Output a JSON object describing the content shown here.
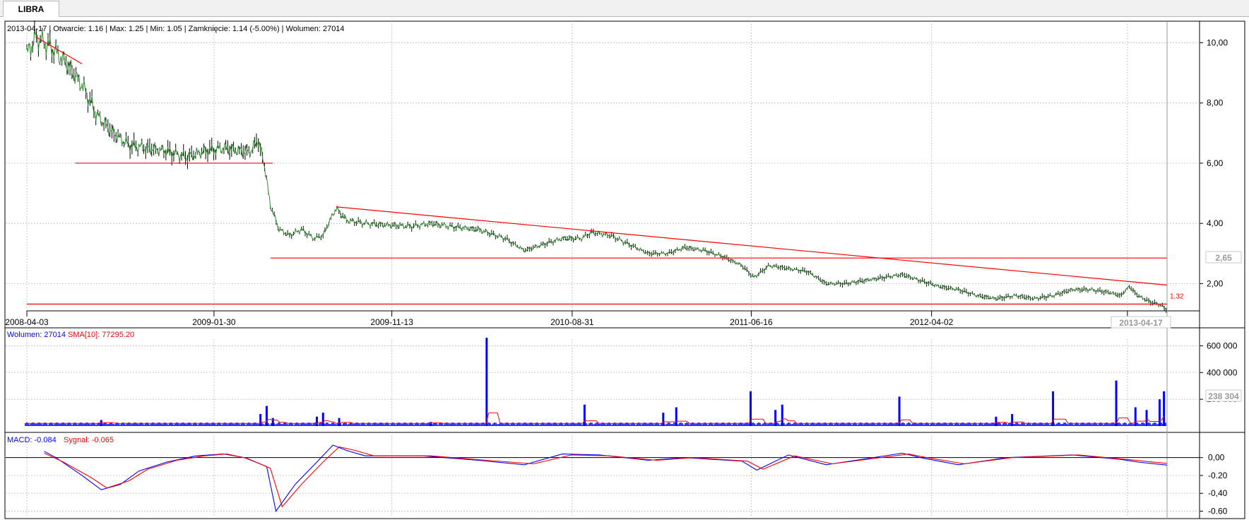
{
  "tab": {
    "label": "LIBRA"
  },
  "colors": {
    "price": "#000000",
    "price_line": "#2f8a2f",
    "trend": "#ff0000",
    "volume": "#0000ff",
    "sma": "#ff0000",
    "macd": "#0000ff",
    "signal": "#ff0000",
    "grid": "#c8c8c8"
  },
  "chart_data": [
    {
      "type": "line",
      "panel": "price",
      "info_text": "2013-04-17 | Otwarcie: 1.16 | Max: 1.25 | Min: 1.05 | Zamknięcie: 1.14 (-5.00%)  | Wolumen: 27014",
      "x_start": "2008-04-03",
      "x_end": "2013-04-17",
      "x_ticks": [
        "2008-04-03",
        "2009-01-30",
        "2009-11-13",
        "2010-08-31",
        "2011-06-16",
        "2012-04-02",
        "2013-0"
      ],
      "x_last_label": "2013-04-17",
      "y_ticks": [
        "10,00",
        "8,00",
        "6,00",
        "4,00",
        "2,00"
      ],
      "ylim": [
        1.0,
        10.2
      ],
      "series": [
        {
          "values": [
            [
              "2008-04-03",
              9.6
            ],
            [
              "2008-04-17",
              10.2
            ],
            [
              "2008-05-15",
              9.8
            ],
            [
              "2008-06-10",
              9.2
            ],
            [
              "2008-07-01",
              8.6
            ],
            [
              "2008-07-25",
              7.6
            ],
            [
              "2008-08-20",
              7.0
            ],
            [
              "2008-09-15",
              6.6
            ],
            [
              "2008-10-15",
              6.5
            ],
            [
              "2008-11-15",
              6.4
            ],
            [
              "2008-12-15",
              6.2
            ],
            [
              "2009-01-15",
              6.4
            ],
            [
              "2009-02-15",
              6.5
            ],
            [
              "2009-03-15",
              6.4
            ],
            [
              "2009-04-01",
              6.4
            ],
            [
              "2009-04-10",
              6.8
            ],
            [
              "2009-04-20",
              6.1
            ],
            [
              "2009-05-01",
              4.6
            ],
            [
              "2009-05-15",
              3.8
            ],
            [
              "2009-06-01",
              3.6
            ],
            [
              "2009-06-20",
              3.8
            ],
            [
              "2009-07-10",
              3.5
            ],
            [
              "2009-07-25",
              3.6
            ],
            [
              "2009-08-05",
              4.1
            ],
            [
              "2009-08-15",
              4.5
            ],
            [
              "2009-09-01",
              4.1
            ],
            [
              "2009-10-01",
              4.0
            ],
            [
              "2009-11-01",
              3.95
            ],
            [
              "2009-12-15",
              3.9
            ],
            [
              "2010-01-15",
              4.0
            ],
            [
              "2010-02-15",
              3.9
            ],
            [
              "2010-04-01",
              3.8
            ],
            [
              "2010-05-15",
              3.5
            ],
            [
              "2010-06-15",
              3.1
            ],
            [
              "2010-07-15",
              3.3
            ],
            [
              "2010-08-15",
              3.5
            ],
            [
              "2010-09-15",
              3.5
            ],
            [
              "2010-10-01",
              3.7
            ],
            [
              "2010-11-01",
              3.6
            ],
            [
              "2010-12-01",
              3.3
            ],
            [
              "2011-01-01",
              3.0
            ],
            [
              "2011-02-01",
              3.0
            ],
            [
              "2011-03-01",
              3.2
            ],
            [
              "2011-04-01",
              3.1
            ],
            [
              "2011-05-01",
              2.9
            ],
            [
              "2011-06-01",
              2.6
            ],
            [
              "2011-06-20",
              2.2
            ],
            [
              "2011-07-15",
              2.6
            ],
            [
              "2011-08-15",
              2.5
            ],
            [
              "2011-09-15",
              2.4
            ],
            [
              "2011-10-15",
              2.0
            ],
            [
              "2011-11-15",
              2.0
            ],
            [
              "2011-12-15",
              2.1
            ],
            [
              "2012-01-15",
              2.2
            ],
            [
              "2012-02-15",
              2.3
            ],
            [
              "2012-03-15",
              2.1
            ],
            [
              "2012-04-15",
              1.9
            ],
            [
              "2012-05-15",
              1.8
            ],
            [
              "2012-06-15",
              1.6
            ],
            [
              "2012-07-15",
              1.5
            ],
            [
              "2012-08-15",
              1.6
            ],
            [
              "2012-09-15",
              1.5
            ],
            [
              "2012-10-15",
              1.6
            ],
            [
              "2012-11-15",
              1.8
            ],
            [
              "2012-12-15",
              1.8
            ],
            [
              "2013-01-15",
              1.7
            ],
            [
              "2013-02-01",
              1.6
            ],
            [
              "2013-02-15",
              1.9
            ],
            [
              "2013-03-01",
              1.6
            ],
            [
              "2013-03-20",
              1.4
            ],
            [
              "2013-04-05",
              1.3
            ],
            [
              "2013-04-17",
              1.14
            ]
          ]
        }
      ],
      "trend_lines": [
        {
          "x": [
            "2008-04-17",
            "2008-07-01"
          ],
          "y": [
            10.2,
            9.3
          ]
        },
        {
          "x": [
            "2008-06-20",
            "2009-05-05"
          ],
          "y": [
            6.0,
            6.0
          ]
        },
        {
          "x": [
            "2009-05-01",
            "2013-04-17"
          ],
          "y": [
            2.85,
            2.85
          ]
        },
        {
          "x": [
            "2009-08-15",
            "2013-04-17"
          ],
          "y": [
            4.55,
            1.95
          ]
        },
        {
          "x": [
            "2008-04-03",
            "2013-04-17"
          ],
          "y": [
            1.32,
            1.32
          ]
        }
      ],
      "price_box": "2,65",
      "level_label": "1,32"
    },
    {
      "type": "bar",
      "panel": "volume",
      "legend": [
        {
          "label": "Wolumen: 27014",
          "color": "#0000ff"
        },
        {
          "label": "SMA[10]: 77295.20",
          "color": "#ff0000"
        }
      ],
      "y_ticks": [
        "600 000",
        "400 000",
        "200 000"
      ],
      "ylim": [
        0,
        650000
      ],
      "box_label": "238 304",
      "spikes": [
        [
          "2008-08-01",
          45000
        ],
        [
          "2009-04-15",
          90000
        ],
        [
          "2009-04-25",
          150000
        ],
        [
          "2009-05-05",
          60000
        ],
        [
          "2009-07-15",
          70000
        ],
        [
          "2009-07-25",
          100000
        ],
        [
          "2009-08-20",
          60000
        ],
        [
          "2010-01-15",
          30000
        ],
        [
          "2010-04-15",
          660000
        ],
        [
          "2010-09-20",
          160000
        ],
        [
          "2011-01-25",
          100000
        ],
        [
          "2011-02-15",
          140000
        ],
        [
          "2011-06-15",
          260000
        ],
        [
          "2011-07-25",
          120000
        ],
        [
          "2011-08-05",
          160000
        ],
        [
          "2012-02-10",
          220000
        ],
        [
          "2012-07-15",
          70000
        ],
        [
          "2012-08-10",
          90000
        ],
        [
          "2012-10-15",
          260000
        ],
        [
          "2013-01-25",
          340000
        ],
        [
          "2013-02-25",
          140000
        ],
        [
          "2013-03-15",
          120000
        ],
        [
          "2013-04-05",
          200000
        ],
        [
          "2013-04-12",
          260000
        ]
      ],
      "base_level": 18000
    },
    {
      "type": "line",
      "panel": "macd",
      "legend": [
        {
          "label": "MACD: -0.084",
          "color": "#0000ff"
        },
        {
          "label": "Sygnał: -0.065",
          "color": "#ff0000"
        }
      ],
      "y_ticks": [
        "0,00",
        "-0.20",
        "-0,40",
        "-0.60"
      ],
      "ylim": [
        -0.62,
        0.14
      ],
      "series": [
        {
          "label": "MACD",
          "values": [
            [
              "2008-05-01",
              0.07
            ],
            [
              "2008-05-20",
              0.0
            ],
            [
              "2008-07-01",
              -0.2
            ],
            [
              "2008-08-01",
              -0.36
            ],
            [
              "2008-09-01",
              -0.3
            ],
            [
              "2008-10-01",
              -0.15
            ],
            [
              "2008-11-15",
              -0.05
            ],
            [
              "2009-01-01",
              0.02
            ],
            [
              "2009-02-15",
              0.04
            ],
            [
              "2009-03-20",
              0.0
            ],
            [
              "2009-04-25",
              -0.1
            ],
            [
              "2009-05-10",
              -0.6
            ],
            [
              "2009-06-10",
              -0.3
            ],
            [
              "2009-07-15",
              -0.05
            ],
            [
              "2009-08-10",
              0.14
            ],
            [
              "2009-09-01",
              0.08
            ],
            [
              "2009-10-01",
              0.02
            ],
            [
              "2010-01-01",
              0.02
            ],
            [
              "2010-04-01",
              -0.03
            ],
            [
              "2010-06-15",
              -0.08
            ],
            [
              "2010-08-15",
              0.04
            ],
            [
              "2010-10-15",
              0.03
            ],
            [
              "2011-01-01",
              -0.03
            ],
            [
              "2011-03-01",
              0.0
            ],
            [
              "2011-06-01",
              -0.04
            ],
            [
              "2011-06-25",
              -0.14
            ],
            [
              "2011-08-15",
              0.03
            ],
            [
              "2011-10-15",
              -0.08
            ],
            [
              "2012-02-15",
              0.05
            ],
            [
              "2012-03-15",
              0.0
            ],
            [
              "2012-05-15",
              -0.08
            ],
            [
              "2012-08-01",
              0.0
            ],
            [
              "2012-11-15",
              0.03
            ],
            [
              "2013-02-01",
              -0.02
            ],
            [
              "2013-03-01",
              -0.05
            ],
            [
              "2013-04-17",
              -0.084
            ]
          ]
        },
        {
          "label": "Sygnał",
          "values": [
            [
              "2008-05-01",
              0.05
            ],
            [
              "2008-06-01",
              -0.05
            ],
            [
              "2008-07-15",
              -0.22
            ],
            [
              "2008-08-10",
              -0.34
            ],
            [
              "2008-09-15",
              -0.26
            ],
            [
              "2008-10-15",
              -0.13
            ],
            [
              "2008-12-01",
              -0.03
            ],
            [
              "2009-01-15",
              0.02
            ],
            [
              "2009-02-20",
              0.04
            ],
            [
              "2009-03-25",
              -0.01
            ],
            [
              "2009-05-01",
              -0.12
            ],
            [
              "2009-05-20",
              -0.55
            ],
            [
              "2009-06-20",
              -0.3
            ],
            [
              "2009-07-25",
              -0.05
            ],
            [
              "2009-08-20",
              0.12
            ],
            [
              "2009-09-15",
              0.08
            ],
            [
              "2009-10-15",
              0.02
            ],
            [
              "2010-01-15",
              0.02
            ],
            [
              "2010-04-15",
              -0.03
            ],
            [
              "2010-06-30",
              -0.07
            ],
            [
              "2010-08-30",
              0.03
            ],
            [
              "2010-10-30",
              0.02
            ],
            [
              "2011-01-15",
              -0.03
            ],
            [
              "2011-03-15",
              0.0
            ],
            [
              "2011-06-10",
              -0.04
            ],
            [
              "2011-07-05",
              -0.13
            ],
            [
              "2011-08-25",
              0.02
            ],
            [
              "2011-10-25",
              -0.07
            ],
            [
              "2012-02-25",
              0.04
            ],
            [
              "2012-03-25",
              0.0
            ],
            [
              "2012-05-25",
              -0.07
            ],
            [
              "2012-08-10",
              0.0
            ],
            [
              "2012-11-25",
              0.03
            ],
            [
              "2013-02-10",
              -0.02
            ],
            [
              "2013-03-10",
              -0.04
            ],
            [
              "2013-04-17",
              -0.065
            ]
          ]
        }
      ]
    }
  ]
}
